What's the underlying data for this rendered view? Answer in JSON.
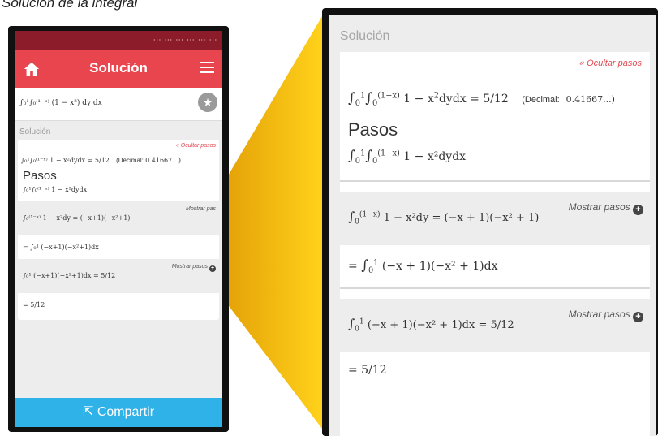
{
  "caption": "Solución de la integral",
  "phone": {
    "status_text": "⋯ ⋯ ⋯ ⋯ ⋯ ⋯",
    "header_title": "Solución",
    "integral": "∫₀¹∫₀⁽¹⁻ˣ⁾ (1 − x²) dy dx",
    "section_label": "Solución",
    "hide_steps": "« Ocultar pasos",
    "result_eq": "∫₀¹∫₀⁽¹⁻ˣ⁾ 1 − x²dydx = 5/12",
    "decimal_label": "(Decimal:",
    "decimal_value": "0.41667...)",
    "steps_heading": "Pasos",
    "steps_integral": "∫₀¹∫₀⁽¹⁻ˣ⁾ 1 − x²dydx",
    "step1_eq": "∫₀⁽¹⁻ˣ⁾ 1 − x²dy = (−x+1)(−x²+1)",
    "step1_button": "Mostrar pas",
    "step1_result": "= ∫₀¹ (−x+1)(−x²+1)dx",
    "step2_eq": "∫₀¹ (−x+1)(−x²+1)dx = 5/12",
    "step2_button": "Mostrar pasos",
    "final": "= 5/12",
    "share_label": "Compartir"
  },
  "zoom": {
    "section_label": "Solución",
    "hide_steps": "« Ocultar pasos",
    "result_lhs": "1 − x",
    "result_rhs": "dydx = ",
    "result_frac": "5/12",
    "decimal_label": "(Decimal:",
    "decimal_value": "0.41667...)",
    "steps_heading": "Pasos",
    "steps_integral": "1 − x²dydx",
    "step1_eq": "1 − x²dy = (−x + 1)(−x² + 1)",
    "step1_button": "Mostrar pasos",
    "step1_result": "(−x + 1)(−x² + 1)dx",
    "step2_eq": "(−x + 1)(−x² + 1)dx = ",
    "step2_frac": "5/12",
    "step2_button": "Mostrar pasos",
    "final": "= 5/12"
  },
  "colors": {
    "header_red": "#e8454f",
    "share_blue": "#2fb2e8",
    "connector_yellow": "#f2b705"
  }
}
